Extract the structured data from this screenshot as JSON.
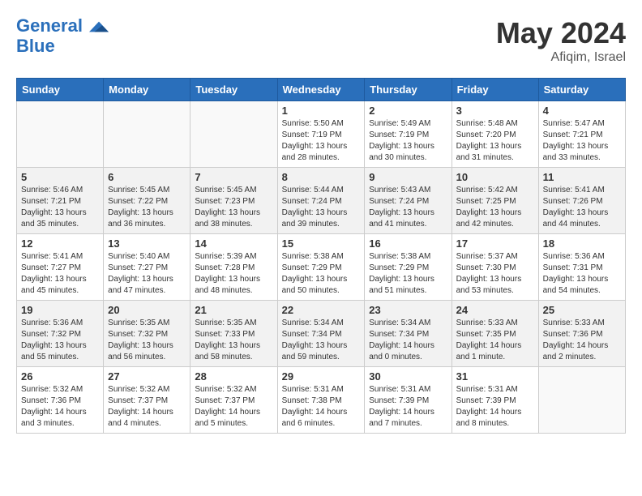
{
  "header": {
    "logo_line1": "General",
    "logo_line2": "Blue",
    "month_year": "May 2024",
    "location": "Afiqim, Israel"
  },
  "weekdays": [
    "Sunday",
    "Monday",
    "Tuesday",
    "Wednesday",
    "Thursday",
    "Friday",
    "Saturday"
  ],
  "weeks": [
    [
      {
        "day": "",
        "info": ""
      },
      {
        "day": "",
        "info": ""
      },
      {
        "day": "",
        "info": ""
      },
      {
        "day": "1",
        "info": "Sunrise: 5:50 AM\nSunset: 7:19 PM\nDaylight: 13 hours\nand 28 minutes."
      },
      {
        "day": "2",
        "info": "Sunrise: 5:49 AM\nSunset: 7:19 PM\nDaylight: 13 hours\nand 30 minutes."
      },
      {
        "day": "3",
        "info": "Sunrise: 5:48 AM\nSunset: 7:20 PM\nDaylight: 13 hours\nand 31 minutes."
      },
      {
        "day": "4",
        "info": "Sunrise: 5:47 AM\nSunset: 7:21 PM\nDaylight: 13 hours\nand 33 minutes."
      }
    ],
    [
      {
        "day": "5",
        "info": "Sunrise: 5:46 AM\nSunset: 7:21 PM\nDaylight: 13 hours\nand 35 minutes."
      },
      {
        "day": "6",
        "info": "Sunrise: 5:45 AM\nSunset: 7:22 PM\nDaylight: 13 hours\nand 36 minutes."
      },
      {
        "day": "7",
        "info": "Sunrise: 5:45 AM\nSunset: 7:23 PM\nDaylight: 13 hours\nand 38 minutes."
      },
      {
        "day": "8",
        "info": "Sunrise: 5:44 AM\nSunset: 7:24 PM\nDaylight: 13 hours\nand 39 minutes."
      },
      {
        "day": "9",
        "info": "Sunrise: 5:43 AM\nSunset: 7:24 PM\nDaylight: 13 hours\nand 41 minutes."
      },
      {
        "day": "10",
        "info": "Sunrise: 5:42 AM\nSunset: 7:25 PM\nDaylight: 13 hours\nand 42 minutes."
      },
      {
        "day": "11",
        "info": "Sunrise: 5:41 AM\nSunset: 7:26 PM\nDaylight: 13 hours\nand 44 minutes."
      }
    ],
    [
      {
        "day": "12",
        "info": "Sunrise: 5:41 AM\nSunset: 7:27 PM\nDaylight: 13 hours\nand 45 minutes."
      },
      {
        "day": "13",
        "info": "Sunrise: 5:40 AM\nSunset: 7:27 PM\nDaylight: 13 hours\nand 47 minutes."
      },
      {
        "day": "14",
        "info": "Sunrise: 5:39 AM\nSunset: 7:28 PM\nDaylight: 13 hours\nand 48 minutes."
      },
      {
        "day": "15",
        "info": "Sunrise: 5:38 AM\nSunset: 7:29 PM\nDaylight: 13 hours\nand 50 minutes."
      },
      {
        "day": "16",
        "info": "Sunrise: 5:38 AM\nSunset: 7:29 PM\nDaylight: 13 hours\nand 51 minutes."
      },
      {
        "day": "17",
        "info": "Sunrise: 5:37 AM\nSunset: 7:30 PM\nDaylight: 13 hours\nand 53 minutes."
      },
      {
        "day": "18",
        "info": "Sunrise: 5:36 AM\nSunset: 7:31 PM\nDaylight: 13 hours\nand 54 minutes."
      }
    ],
    [
      {
        "day": "19",
        "info": "Sunrise: 5:36 AM\nSunset: 7:32 PM\nDaylight: 13 hours\nand 55 minutes."
      },
      {
        "day": "20",
        "info": "Sunrise: 5:35 AM\nSunset: 7:32 PM\nDaylight: 13 hours\nand 56 minutes."
      },
      {
        "day": "21",
        "info": "Sunrise: 5:35 AM\nSunset: 7:33 PM\nDaylight: 13 hours\nand 58 minutes."
      },
      {
        "day": "22",
        "info": "Sunrise: 5:34 AM\nSunset: 7:34 PM\nDaylight: 13 hours\nand 59 minutes."
      },
      {
        "day": "23",
        "info": "Sunrise: 5:34 AM\nSunset: 7:34 PM\nDaylight: 14 hours\nand 0 minutes."
      },
      {
        "day": "24",
        "info": "Sunrise: 5:33 AM\nSunset: 7:35 PM\nDaylight: 14 hours\nand 1 minute."
      },
      {
        "day": "25",
        "info": "Sunrise: 5:33 AM\nSunset: 7:36 PM\nDaylight: 14 hours\nand 2 minutes."
      }
    ],
    [
      {
        "day": "26",
        "info": "Sunrise: 5:32 AM\nSunset: 7:36 PM\nDaylight: 14 hours\nand 3 minutes."
      },
      {
        "day": "27",
        "info": "Sunrise: 5:32 AM\nSunset: 7:37 PM\nDaylight: 14 hours\nand 4 minutes."
      },
      {
        "day": "28",
        "info": "Sunrise: 5:32 AM\nSunset: 7:37 PM\nDaylight: 14 hours\nand 5 minutes."
      },
      {
        "day": "29",
        "info": "Sunrise: 5:31 AM\nSunset: 7:38 PM\nDaylight: 14 hours\nand 6 minutes."
      },
      {
        "day": "30",
        "info": "Sunrise: 5:31 AM\nSunset: 7:39 PM\nDaylight: 14 hours\nand 7 minutes."
      },
      {
        "day": "31",
        "info": "Sunrise: 5:31 AM\nSunset: 7:39 PM\nDaylight: 14 hours\nand 8 minutes."
      },
      {
        "day": "",
        "info": ""
      }
    ]
  ]
}
